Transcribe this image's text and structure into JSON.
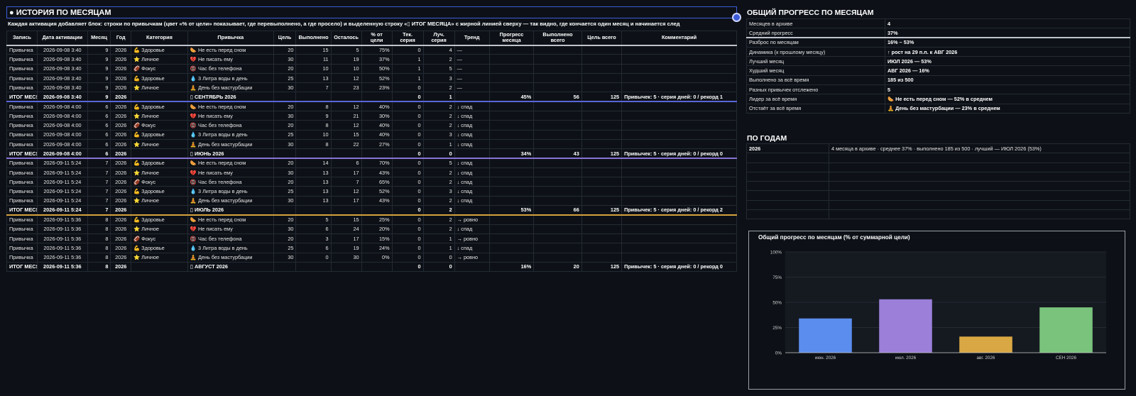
{
  "left": {
    "title": "● ИСТОРИЯ ПО МЕСЯЦАМ",
    "subtitle": "Каждая активация добавляет блок: строки по привычкам (цвет «% от цели» показывает, где перевыполнено, а где просело) и выделенную строку «▯ ИТОГ МЕСЯЦА» с жирной линией сверху — так видно, где кончается один месяц и начинается след",
    "headers": [
      "Запись",
      "Дата активации",
      "Месяц",
      "Год",
      "Категория",
      "Привычка",
      "Цель",
      "Выполнено",
      "Осталось",
      "% от цели",
      "Тек. серия",
      "Луч. серия",
      "Тренд",
      "Прогресс месяца",
      "Выполнено всего",
      "Цель всего",
      "Комментарий"
    ],
    "rows": [
      {
        "cells": [
          "Привычка",
          "2026-09-08 3:40",
          "9",
          "2026",
          "💪 Здоровье",
          "🌭 Не есть перед сном",
          "20",
          "15",
          "5",
          "75%",
          "0",
          "4",
          "—",
          "",
          "",
          "",
          ""
        ]
      },
      {
        "cells": [
          "Привычка",
          "2026-09-08 3:40",
          "9",
          "2026",
          "⭐ Личное",
          "💔 Не писать ему",
          "30",
          "11",
          "19",
          "37%",
          "1",
          "2",
          "—",
          "",
          "",
          "",
          ""
        ]
      },
      {
        "cells": [
          "Привычка",
          "2026-09-08 3:40",
          "9",
          "2026",
          "🏈 Фокус",
          "📵 Час без телефона",
          "20",
          "10",
          "10",
          "50%",
          "1",
          "5",
          "—",
          "",
          "",
          "",
          ""
        ]
      },
      {
        "cells": [
          "Привычка",
          "2026-09-08 3:40",
          "9",
          "2026",
          "💪 Здоровье",
          "💧 3 Литра воды в день",
          "25",
          "13",
          "12",
          "52%",
          "1",
          "3",
          "—",
          "",
          "",
          "",
          ""
        ]
      },
      {
        "cells": [
          "Привычка",
          "2026-09-08 3:40",
          "9",
          "2026",
          "⭐ Личное",
          "🧘 День без мастурбации",
          "30",
          "7",
          "23",
          "23%",
          "0",
          "2",
          "—",
          "",
          "",
          "",
          ""
        ]
      },
      {
        "total": 0,
        "cells": [
          "ИТОГ МЕСЯЦА",
          "2026-09-08 3:40",
          "9",
          "2026",
          "",
          "▯ СЕНТЯБРЬ 2026",
          "",
          "",
          "",
          "",
          "0",
          "1",
          "",
          "45%",
          "56",
          "125",
          "Привычек: 5 · серия дней: 0 / рекорд 1"
        ]
      },
      {
        "cells": [
          "Привычка",
          "2026-09-08 4:00",
          "6",
          "2026",
          "💪 Здоровье",
          "🌭 Не есть перед сном",
          "20",
          "8",
          "12",
          "40%",
          "0",
          "2",
          "↓ спад",
          "",
          "",
          "",
          ""
        ]
      },
      {
        "cells": [
          "Привычка",
          "2026-09-08 4:00",
          "6",
          "2026",
          "⭐ Личное",
          "💔 Не писать ему",
          "30",
          "9",
          "21",
          "30%",
          "0",
          "2",
          "↓ спад",
          "",
          "",
          "",
          ""
        ]
      },
      {
        "cells": [
          "Привычка",
          "2026-09-08 4:00",
          "6",
          "2026",
          "🏈 Фокус",
          "📵 Час без телефона",
          "20",
          "8",
          "12",
          "40%",
          "0",
          "2",
          "↓ спад",
          "",
          "",
          "",
          ""
        ]
      },
      {
        "cells": [
          "Привычка",
          "2026-09-08 4:00",
          "6",
          "2026",
          "💪 Здоровье",
          "💧 3 Литра воды в день",
          "25",
          "10",
          "15",
          "40%",
          "0",
          "3",
          "↓ спад",
          "",
          "",
          "",
          ""
        ]
      },
      {
        "cells": [
          "Привычка",
          "2026-09-08 4:00",
          "6",
          "2026",
          "⭐ Личное",
          "🧘 День без мастурбации",
          "30",
          "8",
          "22",
          "27%",
          "0",
          "1",
          "↓ спад",
          "",
          "",
          "",
          ""
        ]
      },
      {
        "total": 1,
        "cells": [
          "ИТОГ МЕСЯЦА",
          "2026-09-08 4:00",
          "6",
          "2026",
          "",
          "▯ ИЮНЬ 2026",
          "",
          "",
          "",
          "",
          "0",
          "0",
          "",
          "34%",
          "43",
          "125",
          "Привычек: 5 · серия дней: 0 / рекорд 0"
        ]
      },
      {
        "cells": [
          "Привычка",
          "2026-09-11 5:24",
          "7",
          "2026",
          "💪 Здоровье",
          "🌭 Не есть перед сном",
          "20",
          "14",
          "6",
          "70%",
          "0",
          "5",
          "↓ спад",
          "",
          "",
          "",
          ""
        ]
      },
      {
        "cells": [
          "Привычка",
          "2026-09-11 5:24",
          "7",
          "2026",
          "⭐ Личное",
          "💔 Не писать ему",
          "30",
          "13",
          "17",
          "43%",
          "0",
          "2",
          "↓ спад",
          "",
          "",
          "",
          ""
        ]
      },
      {
        "cells": [
          "Привычка",
          "2026-09-11 5:24",
          "7",
          "2026",
          "🏈 Фокус",
          "📵 Час без телефона",
          "20",
          "13",
          "7",
          "65%",
          "0",
          "2",
          "↓ спад",
          "",
          "",
          "",
          ""
        ]
      },
      {
        "cells": [
          "Привычка",
          "2026-09-11 5:24",
          "7",
          "2026",
          "💪 Здоровье",
          "💧 3 Литра воды в день",
          "25",
          "13",
          "12",
          "52%",
          "0",
          "3",
          "↓ спад",
          "",
          "",
          "",
          ""
        ]
      },
      {
        "cells": [
          "Привычка",
          "2026-09-11 5:24",
          "7",
          "2026",
          "⭐ Личное",
          "🧘 День без мастурбации",
          "30",
          "13",
          "17",
          "43%",
          "0",
          "2",
          "↓ спад",
          "",
          "",
          "",
          ""
        ]
      },
      {
        "total": 2,
        "cells": [
          "ИТОГ МЕСЯЦА",
          "2026-09-11 5:24",
          "7",
          "2026",
          "",
          "▯ ИЮЛЬ 2026",
          "",
          "",
          "",
          "",
          "0",
          "2",
          "",
          "53%",
          "66",
          "125",
          "Привычек: 5 · серия дней: 0 / рекорд 2"
        ]
      },
      {
        "cells": [
          "Привычка",
          "2026-09-11 5:36",
          "8",
          "2026",
          "💪 Здоровье",
          "🌭 Не есть перед сном",
          "20",
          "5",
          "15",
          "25%",
          "0",
          "2",
          "→ ровно",
          "",
          "",
          "",
          ""
        ]
      },
      {
        "cells": [
          "Привычка",
          "2026-09-11 5:36",
          "8",
          "2026",
          "⭐ Личное",
          "💔 Не писать ему",
          "30",
          "6",
          "24",
          "20%",
          "0",
          "2",
          "↓ спад",
          "",
          "",
          "",
          ""
        ]
      },
      {
        "cells": [
          "Привычка",
          "2026-09-11 5:36",
          "8",
          "2026",
          "🏈 Фокус",
          "📵 Час без телефона",
          "20",
          "3",
          "17",
          "15%",
          "0",
          "1",
          "→ ровно",
          "",
          "",
          "",
          ""
        ]
      },
      {
        "cells": [
          "Привычка",
          "2026-09-11 5:36",
          "8",
          "2026",
          "💪 Здоровье",
          "💧 3 Литра воды в день",
          "25",
          "6",
          "19",
          "24%",
          "0",
          "1",
          "↓ спад",
          "",
          "",
          "",
          ""
        ]
      },
      {
        "cells": [
          "Привычка",
          "2026-09-11 5:36",
          "8",
          "2026",
          "⭐ Личное",
          "🧘 День без мастурбации",
          "30",
          "0",
          "30",
          "0%",
          "0",
          "0",
          "→ ровно",
          "",
          "",
          "",
          ""
        ]
      },
      {
        "total": 3,
        "cells": [
          "ИТОГ МЕСЯЦА",
          "2026-09-11 5:36",
          "8",
          "2026",
          "",
          "▯ АВГУСТ 2026",
          "",
          "",
          "",
          "",
          "0",
          "0",
          "",
          "16%",
          "20",
          "125",
          "Привычек: 5 · серия дней: 0 / рекорд 0"
        ]
      }
    ]
  },
  "summary": {
    "title": "ОБЩИЙ ПРОГРЕСС ПО МЕСЯЦАМ",
    "rows": [
      [
        "Месяцев в архиве",
        "4"
      ],
      [
        "Средний прогресс",
        "37%"
      ],
      [
        "Разброс по месяцам",
        "16% – 53%"
      ],
      [
        "Динамика (к прошлому месяцу)",
        "↑ рост на 29 п.п. к АВГ 2026"
      ],
      [
        "Лучший месяц",
        "ИЮЛ 2026 — 53%"
      ],
      [
        "Худший месяц",
        "АВГ 2026 — 16%"
      ],
      [
        "Выполнено за всё время",
        "185 из 500"
      ],
      [
        "Разных привычек отслежено",
        "5"
      ],
      [
        "Лидер за всё время",
        "🌭 Не есть перед сном — 52% в среднем"
      ],
      [
        "Отстаёт за всё время",
        "🧘 День без мастурбации — 23% в среднем"
      ]
    ]
  },
  "years": {
    "title": "ПО ГОДАМ",
    "rows": [
      [
        "2026",
        "4 месяца в архиве · среднее 37% · выполнено 185 из 500 · лучший — ИЮЛ 2026 (53%)"
      ]
    ]
  },
  "chart_data": {
    "type": "bar",
    "title": "Общий прогресс по месяцам (% от суммарной цели)",
    "categories": [
      "июн. 2026",
      "июл. 2026",
      "авг. 2026",
      "СЕН 2026"
    ],
    "values": [
      34,
      53,
      16,
      45
    ],
    "colors": [
      "#5b8def",
      "#9b7fd9",
      "#d9a844",
      "#79c37c"
    ],
    "ylim": [
      0,
      100
    ],
    "yticks": [
      "0%",
      "25%",
      "50%",
      "75%",
      "100%"
    ],
    "grid": true
  }
}
